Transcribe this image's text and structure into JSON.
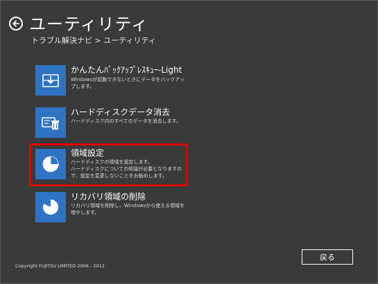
{
  "header": {
    "title": "ユーティリティ",
    "breadcrumb": "トラブル解決ナビ > ユーティリティ"
  },
  "items": [
    {
      "title": "かんたんﾊﾞｯｸｱｯﾌﾟﾚｽｷｭｰ-Light",
      "desc": "Windowsが起動できないときにデータをバックアップします。",
      "icon": "backup-icon"
    },
    {
      "title": "ハードディスクデータ消去",
      "desc": "ハードディスク内のすべてのデータを消去します。",
      "icon": "disk-erase-icon"
    },
    {
      "title": "領域設定",
      "desc": "ハードディスクの領域を設定します。\nハードディスクについての知識が必要となりますので、設定を変更しないことをお勧めします。",
      "icon": "partition-icon",
      "highlighted": true
    },
    {
      "title": "リカバリ領域の削除",
      "desc": "リカバリ領域を削除し、Windowsから使える領域を増やします。",
      "icon": "pie-chart-icon"
    }
  ],
  "footer": {
    "return_label": "戻る",
    "copyright": "Copyright FUJITSU LIMITED 2006 - 2012"
  },
  "colors": {
    "background": "#3a3a3a",
    "tile": "#2f74c4",
    "highlight": "#e20000",
    "text": "#ffffff"
  }
}
